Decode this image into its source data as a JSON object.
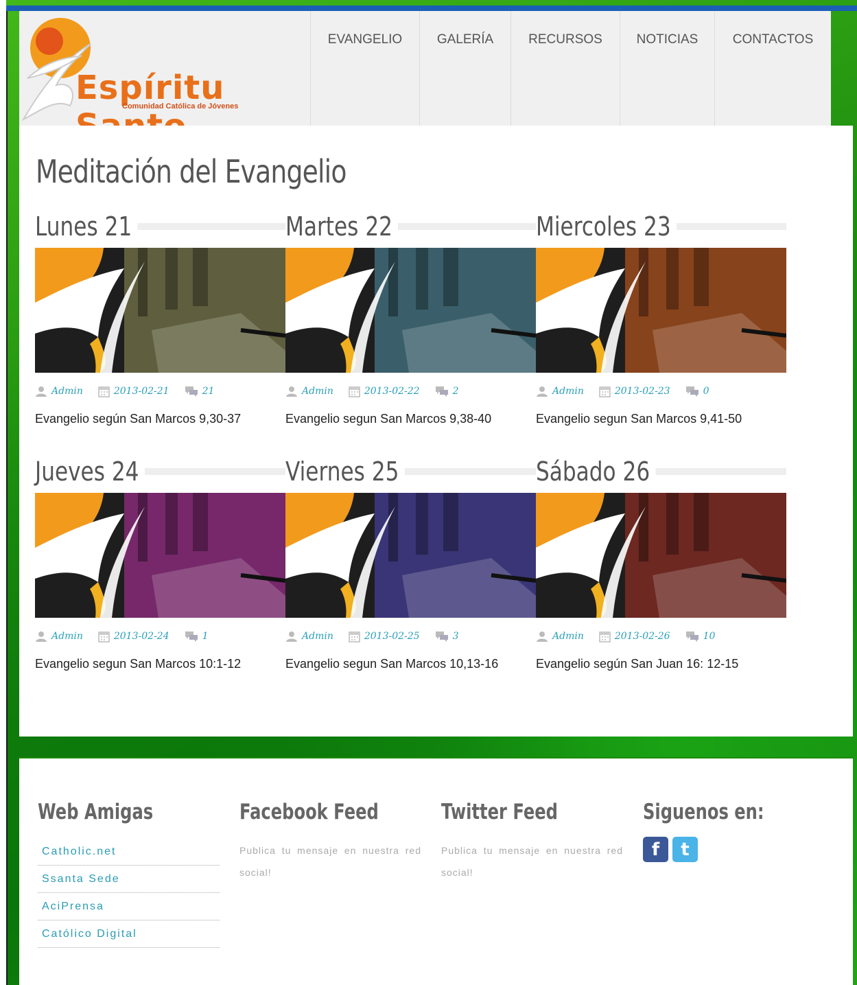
{
  "brand": {
    "title": "Espíritu Santo",
    "subtitle": "Comunidad Católica de Jóvenes",
    "accent": "#e8701a"
  },
  "nav": [
    {
      "label": "EVANGELIO"
    },
    {
      "label": "GALERÍA"
    },
    {
      "label": "RECURSOS"
    },
    {
      "label": "NOTICIAS"
    },
    {
      "label": "CONTACTOS"
    }
  ],
  "page": {
    "title": "Meditación del Evangelio"
  },
  "posts": [
    {
      "day": "Lunes 21",
      "author": "Admin",
      "date": "2013-02-21",
      "comments": "21",
      "title": "Evangelio según San Marcos 9,30-37",
      "tint": "#6b6a44"
    },
    {
      "day": "Martes 22",
      "author": "Admin",
      "date": "2013-02-22",
      "comments": "2",
      "title": "Evangelio segun San Marcos 9,38-40",
      "tint": "#3f6b78"
    },
    {
      "day": "Miercoles 23",
      "author": "Admin",
      "date": "2013-02-23",
      "comments": "0",
      "title": "Evangelio segun San Marcos 9,41-50",
      "tint": "#9a4a1c"
    },
    {
      "day": "Jueves 24",
      "author": "Admin",
      "date": "2013-02-24",
      "comments": "1",
      "title": "Evangelio segun San Marcos 10:1-12",
      "tint": "#862a78"
    },
    {
      "day": "Viernes 25",
      "author": "Admin",
      "date": "2013-02-25",
      "comments": "3",
      "title": "Evangelio segun San Marcos 10,13-16",
      "tint": "#3f3a86"
    },
    {
      "day": "Sábado 26",
      "author": "Admin",
      "date": "2013-02-26",
      "comments": "10",
      "title": "Evangelio según San Juan 16: 12-15",
      "tint": "#7a2a22"
    }
  ],
  "footer": {
    "web_amigas": {
      "heading": "Web Amigas",
      "links": [
        "Catholic.net",
        "Ssanta Sede",
        "AciPrensa",
        "Católico Digital"
      ]
    },
    "facebook": {
      "heading": "Facebook Feed",
      "text": "Publica tu mensaje en nuestra red social!"
    },
    "twitter": {
      "heading": "Twitter Feed",
      "text": "Publica tu mensaje en nuestra red social!"
    },
    "social": {
      "heading": "Siguenos en:",
      "facebook_color": "#3b5998",
      "twitter_color": "#4ab3e8"
    }
  }
}
